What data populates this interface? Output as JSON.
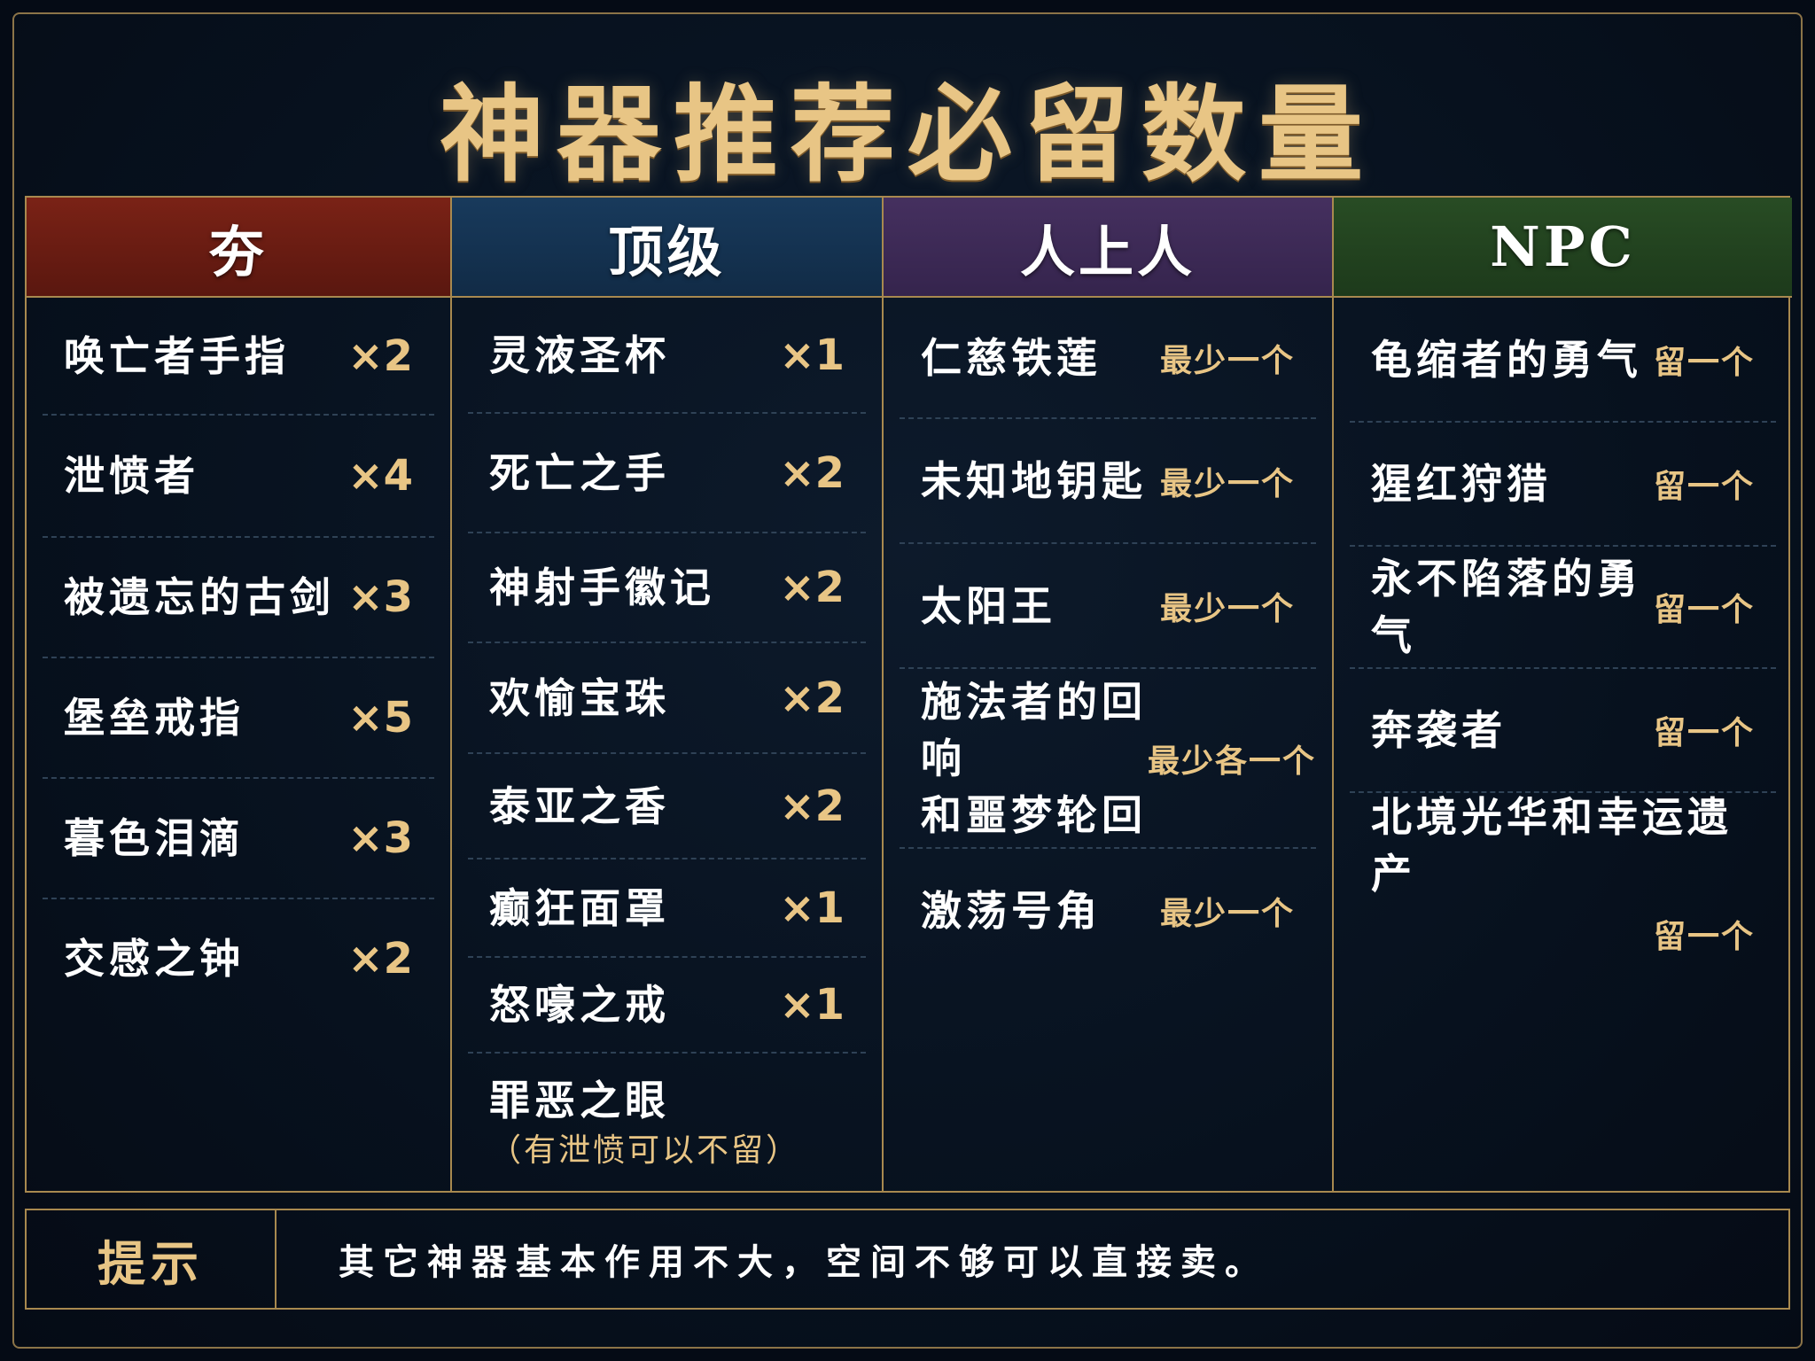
{
  "title": "神器推荐必留数量",
  "colors": {
    "gold": "#e8c585",
    "col1_header": "#6b1d14",
    "col2_header": "#14314f",
    "col3_header": "#3e2a5c",
    "col4_header": "#22421f"
  },
  "columns": [
    {
      "header": "夯",
      "items": [
        {
          "name": "唤亡者手指",
          "qty": "×2"
        },
        {
          "name": "泄愤者",
          "qty": "×4"
        },
        {
          "name": "被遗忘的古剑",
          "qty": "×3"
        },
        {
          "name": "堡垒戒指",
          "qty": "×5"
        },
        {
          "name": "暮色泪滴",
          "qty": "×3"
        },
        {
          "name": "交感之钟",
          "qty": "×2"
        }
      ]
    },
    {
      "header": "顶级",
      "items": [
        {
          "name": "灵液圣杯",
          "qty": "×1"
        },
        {
          "name": "死亡之手",
          "qty": "×2"
        },
        {
          "name": "神射手徽记",
          "qty": "×2"
        },
        {
          "name": "欢愉宝珠",
          "qty": "×2"
        },
        {
          "name": "泰亚之香",
          "qty": "×2"
        },
        {
          "name": "癫狂面罩",
          "qty": "×1"
        },
        {
          "name": "怒嚎之戒",
          "qty": "×1"
        },
        {
          "name": "罪恶之眼",
          "note": "（有泄愤可以不留）"
        }
      ]
    },
    {
      "header": "人上人",
      "items": [
        {
          "name": "仁慈铁莲",
          "qty": "最少一个"
        },
        {
          "name": "未知地钥匙",
          "qty": "最少一个"
        },
        {
          "name": "太阳王",
          "qty": "最少一个"
        },
        {
          "name_line1": "施法者的回响",
          "name_line2": "和噩梦轮回",
          "qty": "最少各一个"
        },
        {
          "name": "激荡号角",
          "qty": "最少一个"
        }
      ]
    },
    {
      "header": "NPC",
      "items": [
        {
          "name": "龟缩者的勇气",
          "qty": "留一个"
        },
        {
          "name": "猩红狩猎",
          "qty": "留一个"
        },
        {
          "name": "永不陷落的勇气",
          "qty": "留一个"
        },
        {
          "name": "奔袭者",
          "qty": "留一个"
        },
        {
          "name": "北境光华和幸运遗产",
          "qty": "留一个"
        }
      ]
    }
  ],
  "tip": {
    "label": "提示",
    "text": "其它神器基本作用不大，空间不够可以直接卖。"
  }
}
